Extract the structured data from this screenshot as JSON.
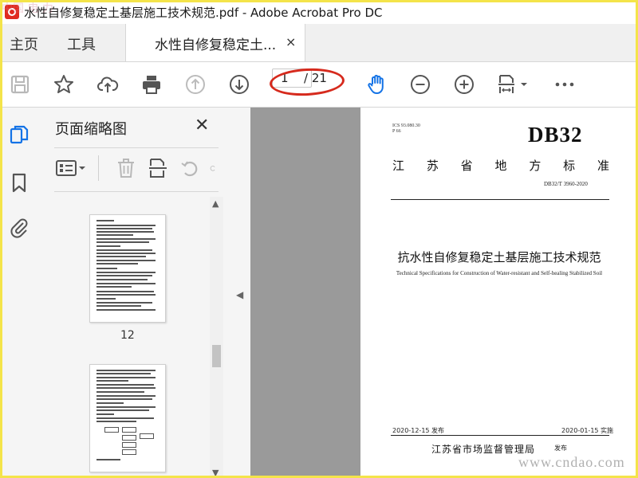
{
  "window": {
    "title": "水性自修复稳定土基层施工技术规范.pdf - Adobe Acrobat Pro DC",
    "watermark_top": "中国 电 力"
  },
  "tabs": {
    "home": "主页",
    "tools": "工具",
    "document": "水性自修复稳定土...",
    "close": "×"
  },
  "toolbar": {
    "icons": [
      "save-icon",
      "bookmark-star-icon",
      "upload-cloud-icon",
      "print-icon",
      "page-up-icon",
      "page-down-icon",
      "hand-icon",
      "zoom-out-icon",
      "zoom-in-icon",
      "page-fit-icon",
      "more-icon"
    ],
    "current_page": "1",
    "total_pages": "/ 21",
    "accent": "#1473e6",
    "annotation_color": "#d62a1d"
  },
  "panel": {
    "title": "页面缩略图",
    "close": "✕",
    "thumbnail_labels": [
      "12"
    ]
  },
  "document": {
    "ics_line1": "ICS 93.080.30",
    "ics_line2": "P 66",
    "code": "DB32",
    "province_chars": [
      "江",
      "苏",
      "省",
      "地",
      "方",
      "标",
      "准"
    ],
    "standard_number": "DB32/T 3960-2020",
    "title_zh": "抗水性自修复稳定土基层施工技术规范",
    "title_en": "Technical Specifications for Construction of Water-resistant and Self-healing Stabilized Soil",
    "publish_date": "2020-12-15 发布",
    "implement_date": "2020-01-15 实施",
    "authority": "江苏省市场监督管理局",
    "authority_suffix": "发布"
  },
  "watermark": "www.cndao.com"
}
